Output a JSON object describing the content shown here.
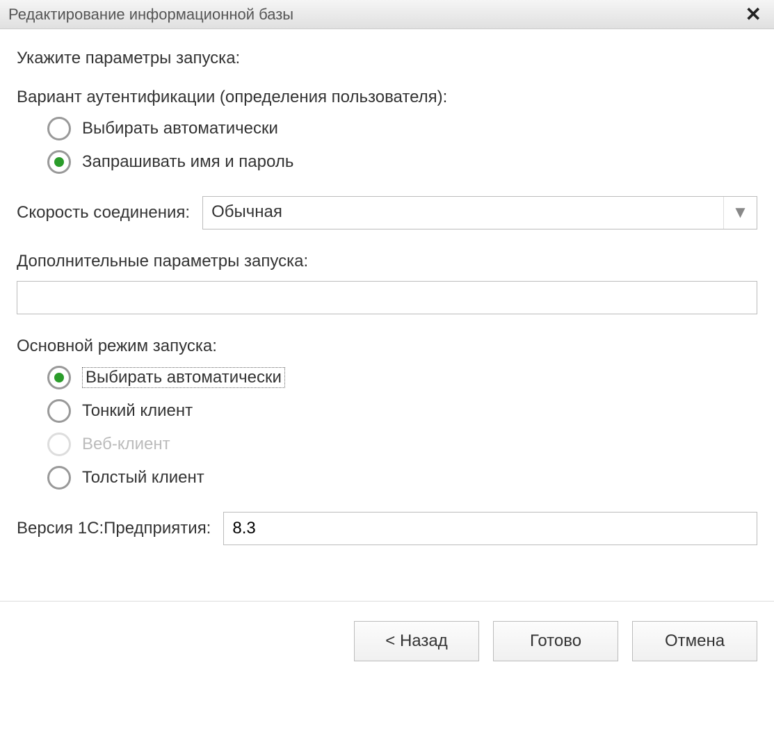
{
  "window": {
    "title": "Редактирование информационной базы"
  },
  "heading": "Укажите параметры запуска:",
  "auth": {
    "label": "Вариант аутентификации (определения пользователя):",
    "options": {
      "auto": "Выбирать автоматически",
      "prompt": "Запрашивать имя и пароль"
    },
    "selected": "prompt"
  },
  "speed": {
    "label": "Скорость соединения:",
    "value": "Обычная"
  },
  "additional": {
    "label": "Дополнительные параметры запуска:",
    "value": ""
  },
  "launch_mode": {
    "label": "Основной режим запуска:",
    "options": {
      "auto": "Выбирать автоматически",
      "thin": "Тонкий клиент",
      "web": "Веб-клиент",
      "thick": "Толстый клиент"
    },
    "selected": "auto",
    "disabled": "web"
  },
  "version": {
    "label": "Версия 1С:Предприятия:",
    "value": "8.3"
  },
  "buttons": {
    "back": "< Назад",
    "finish": "Готово",
    "cancel": "Отмена"
  }
}
